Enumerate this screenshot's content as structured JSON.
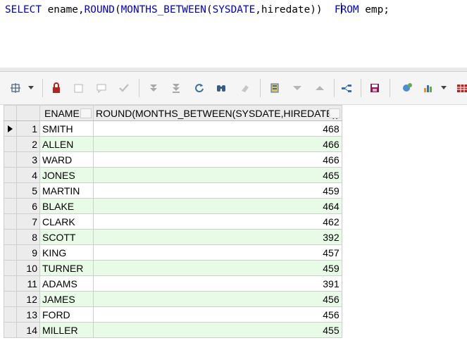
{
  "editor": {
    "sql_kw_select": "SELECT",
    "sql_col1": " ename,",
    "sql_fn_round": "ROUND",
    "sql_paren1": "(",
    "sql_fn_months": "MONTHS_BETWEEN",
    "sql_paren2": "(",
    "sql_kw_sysdate": "SYSDATE",
    "sql_args": ",hiredate))  ",
    "sql_kw_from_a": "F",
    "sql_kw_from_b": "ROM",
    "sql_table": " emp;"
  },
  "toolbar": {
    "icons": [
      "grid-options-icon",
      "lock-icon",
      "new-record-icon",
      "comment-icon",
      "check-icon",
      "first-icon",
      "last-icon",
      "refresh-icon",
      "find-icon",
      "clear-icon",
      "export-icon",
      "sort-desc-icon",
      "sort-asc-icon",
      "query-plan-icon",
      "save-icon",
      "connection-icon",
      "chart-icon",
      "table-icon"
    ]
  },
  "grid": {
    "columns": [
      "ENAME",
      "ROUND(MONTHS_BETWEEN(SYSDATE,HIREDATE))"
    ],
    "rows": [
      {
        "n": "1",
        "ename": "SMITH",
        "value": "468"
      },
      {
        "n": "2",
        "ename": "ALLEN",
        "value": "466"
      },
      {
        "n": "3",
        "ename": "WARD",
        "value": "466"
      },
      {
        "n": "4",
        "ename": "JONES",
        "value": "465"
      },
      {
        "n": "5",
        "ename": "MARTIN",
        "value": "459"
      },
      {
        "n": "6",
        "ename": "BLAKE",
        "value": "464"
      },
      {
        "n": "7",
        "ename": "CLARK",
        "value": "462"
      },
      {
        "n": "8",
        "ename": "SCOTT",
        "value": "392"
      },
      {
        "n": "9",
        "ename": "KING",
        "value": "457"
      },
      {
        "n": "10",
        "ename": "TURNER",
        "value": "459"
      },
      {
        "n": "11",
        "ename": "ADAMS",
        "value": "391"
      },
      {
        "n": "12",
        "ename": "JAMES",
        "value": "456"
      },
      {
        "n": "13",
        "ename": "FORD",
        "value": "456"
      },
      {
        "n": "14",
        "ename": "MILLER",
        "value": "455"
      }
    ],
    "colors": {
      "alt_row": "#e8fbe6",
      "header": "#ececec",
      "keyword": "#0000cc"
    }
  }
}
